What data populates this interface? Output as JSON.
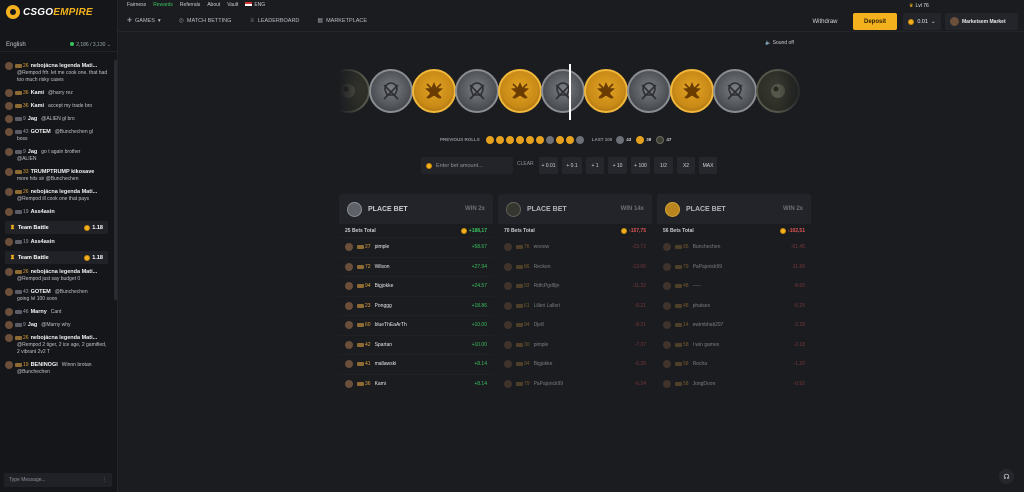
{
  "brand": {
    "name_a": "CSGO",
    "name_b": "EMPIRE"
  },
  "sidebar": {
    "language": "English",
    "online": "2,186 / 3,130",
    "messages": [
      {
        "lvl": "26",
        "lvl_color": "gold",
        "name": "nebojácna legenda Mati...",
        "text": "@Rempod frfr. let me cook one. that had too much risky cases"
      },
      {
        "lvl": "36",
        "lvl_color": "gold",
        "name": "Kami",
        "inline": "@harry rez"
      },
      {
        "lvl": "36",
        "lvl_color": "gold",
        "name": "Kami",
        "inline": "accept my trade bro"
      },
      {
        "lvl": "9",
        "lvl_color": "grey",
        "name": "Jag",
        "inline": "@ALIEN gl bro"
      },
      {
        "lvl": "43",
        "lvl_color": "grey",
        "name": "GOTEM",
        "inline": "@Bunchechen gl",
        "text": "boss"
      },
      {
        "lvl": "9",
        "lvl_color": "grey",
        "name": "Jag",
        "inline": "go t again brother",
        "text": "@ALIEN"
      },
      {
        "lvl": "33",
        "lvl_color": "gold",
        "name": "TRUMPTRUMP kikosave",
        "text": "more hits sir @Bunchechen"
      },
      {
        "lvl": "26",
        "lvl_color": "gold",
        "name": "nebojácna legenda Mati...",
        "text": "@Rempod ill cook one that pays"
      },
      {
        "lvl": "19",
        "lvl_color": "grey",
        "name": "Ass4asin"
      }
    ],
    "team_battle_1": {
      "label": "Team Battle",
      "value": "1.18"
    },
    "messages_2": [
      {
        "lvl": "19",
        "lvl_color": "grey",
        "name": "Ass4asin"
      }
    ],
    "team_battle_2": {
      "label": "Team Battle",
      "value": "1.18"
    },
    "messages_3": [
      {
        "lvl": "26",
        "lvl_color": "gold",
        "name": "nebojácna legenda Mati...",
        "text": "@Rempod just say budget 0"
      },
      {
        "lvl": "43",
        "lvl_color": "grey",
        "name": "GOTEM",
        "inline": "@Bunchechen",
        "text": "going lvl 100 soon"
      },
      {
        "lvl": "46",
        "lvl_color": "grey",
        "name": "Marny",
        "inline": "Cant"
      },
      {
        "lvl": "9",
        "lvl_color": "grey",
        "name": "Jag",
        "inline": "@Marny why"
      },
      {
        "lvl": "26",
        "lvl_color": "gold",
        "name": "nebojácna legenda Mati...",
        "text": "@Rempod 2 tiger, 2 ice age, 2 gamified, 2 vibrant 2v2 T"
      },
      {
        "lvl": "19",
        "lvl_color": "gold",
        "name": "BENINOGI",
        "inline": "Winnn brotan",
        "text": "@Bunchechen"
      }
    ],
    "chat_placeholder": "Type Message..."
  },
  "topbar": {
    "links": [
      "Fairness",
      "Rewards",
      "Referrals",
      "About",
      "Vault"
    ],
    "active": "Rewards",
    "lang": "ENG",
    "level": "Lvl 76"
  },
  "nav": {
    "items": [
      "GAMES",
      "MATCH BETTING",
      "LEADERBOARD",
      "MARKETPLACE"
    ],
    "withdraw": "Withdraw",
    "deposit": "Deposit",
    "balance": "0.01",
    "profile": "Marketsem Market"
  },
  "sound": "Sound off",
  "roulette": {
    "strip": [
      "d",
      "t",
      "ct",
      "t",
      "ct",
      "t",
      "ct",
      "t",
      "ct",
      "t",
      "d"
    ]
  },
  "prev_rolls": {
    "label": "PREVIOUS ROLLS",
    "rolls": [
      "ct",
      "ct",
      "ct",
      "ct",
      "ct",
      "ct",
      "t",
      "ct",
      "ct",
      "t"
    ],
    "last_label": "LAST 100",
    "counts": {
      "t": "43",
      "ct": "38",
      "d": "47"
    }
  },
  "bet": {
    "placeholder": "Enter bet amount...",
    "clear": "CLEAR",
    "buttons": [
      "+ 0.01",
      "+ 0.1",
      "+ 1",
      "+ 10",
      "+ 100",
      "1/2",
      "X2",
      "MAX"
    ]
  },
  "columns": [
    {
      "side": "t",
      "title": "PLACE BET",
      "win": "WIN 2x",
      "total_label": "25 Bets Total",
      "total": "+188,17",
      "total_sign": "pos",
      "rows": [
        {
          "lvl": "27",
          "name": "pimple",
          "amt": "+58.67"
        },
        {
          "lvl": "72",
          "name": "Wilson",
          "amt": "+27.94"
        },
        {
          "lvl": "94",
          "name": "Bigjokke",
          "amt": "+24.57"
        },
        {
          "lvl": "23",
          "name": "Ponggg",
          "amt": "+18.86"
        },
        {
          "lvl": "60",
          "name": "blueThEaArTh",
          "amt": "+10.00"
        },
        {
          "lvl": "42",
          "name": "Spartan",
          "amt": "+10.00"
        },
        {
          "lvl": "41",
          "name": "mallawski",
          "amt": "+8.14"
        },
        {
          "lvl": "36",
          "name": "Kami",
          "amt": "+8.14"
        }
      ]
    },
    {
      "side": "ct",
      "title": "PLACE BET",
      "win": "WIN 14x",
      "total_label": "70 Bets Total",
      "total": "-157,75",
      "total_sign": "neg",
      "rows": [
        {
          "lvl": "76",
          "name": "wooow",
          "amt": "-23.72"
        },
        {
          "lvl": "86",
          "name": "Recken",
          "amt": "-13.06"
        },
        {
          "lvl": "93",
          "name": "RdfcPgd8jn",
          "amt": "-11.32"
        },
        {
          "lvl": "61",
          "name": "Lilleri Lalleri",
          "amt": "-8.21"
        },
        {
          "lvl": "94",
          "name": "Dje8",
          "amt": "-8.21"
        },
        {
          "lvl": "30",
          "name": "pimple",
          "amt": "-7.37"
        },
        {
          "lvl": "94",
          "name": "Bigjokke",
          "amt": "-6.35"
        },
        {
          "lvl": "79",
          "name": "PaPajorick99",
          "amt": "-6.24"
        }
      ]
    },
    {
      "side": "ct",
      "title": "PLACE BET",
      "win": "WIN 2x",
      "total_label": "56 Bets Total",
      "total": "-102,51",
      "total_sign": "neg",
      "rows": [
        {
          "lvl": "95",
          "name": "Bunchechen",
          "amt": "-61.45"
        },
        {
          "lvl": "79",
          "name": "PaPajorick99",
          "amt": "-11.89"
        },
        {
          "lvl": "48",
          "name": "-----",
          "amt": "-8.60"
        },
        {
          "lvl": "48",
          "name": "phatsex",
          "amt": "-6.25"
        },
        {
          "lvl": "14",
          "name": "ewimbhati297",
          "amt": "-2.18"
        },
        {
          "lvl": "58",
          "name": "I win games",
          "amt": "-2.18"
        },
        {
          "lvl": "58",
          "name": "Rocha",
          "amt": "-1.20"
        },
        {
          "lvl": "58",
          "name": "JongDoon",
          "amt": "-0.92"
        }
      ]
    }
  ],
  "colors": {
    "accent": "#f4b11e",
    "green": "#3ac25f",
    "red": "#e25555",
    "bg": "#1b1c20"
  }
}
